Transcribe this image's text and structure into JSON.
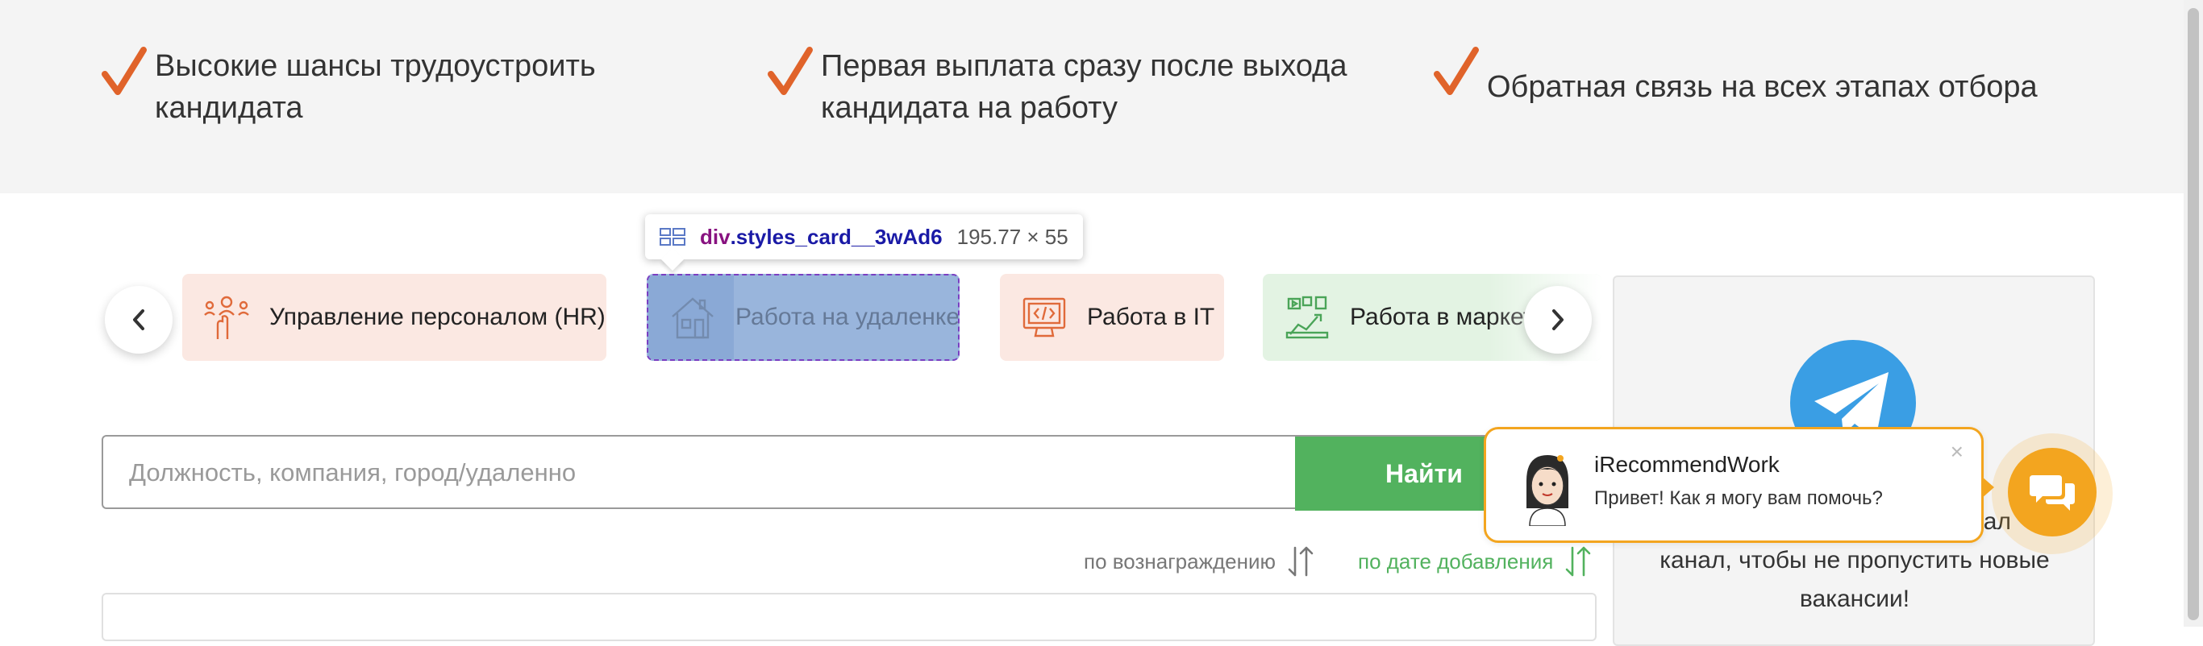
{
  "benefits": [
    {
      "line1": "Высокие шансы трудоустроить",
      "line2": "кандидата"
    },
    {
      "line1": "Первая выплата сразу после выхода",
      "line2": "кандидата на работу"
    },
    {
      "line1": "Обратная связь на всех этапах отбора",
      "line2": ""
    }
  ],
  "categories": [
    {
      "label": "Управление персоналом (HR)",
      "icon": "hr-people-icon"
    },
    {
      "label": "Работа на удаленке",
      "icon": "house-icon"
    },
    {
      "label": "Работа в IT",
      "icon": "laptop-code-icon"
    },
    {
      "label": "Работа в маркетинге",
      "icon": "marketing-icon"
    }
  ],
  "tooltip": {
    "tag": "div",
    "class_name": ".styles_card__3wAd6",
    "dimensions": "195.77 × 55"
  },
  "search": {
    "placeholder": "Должность, компания, город/удаленно",
    "value": "",
    "button_label": "Найти"
  },
  "sort": {
    "by_reward": "по вознаграждению",
    "by_date": "по дате добавления"
  },
  "telegram": {
    "line1": "канал",
    "line2": "канал, чтобы не пропустить новые",
    "line3": "вакансии!"
  },
  "chat": {
    "name": "iRecommendWork",
    "message": "Привет! Как я могу вам помочь?",
    "close": "×"
  },
  "colors": {
    "accent_green": "#52b25e",
    "check_orange": "#e0632a",
    "chat_orange": "#f3a51f",
    "telegram_blue": "#3a9ee4"
  }
}
